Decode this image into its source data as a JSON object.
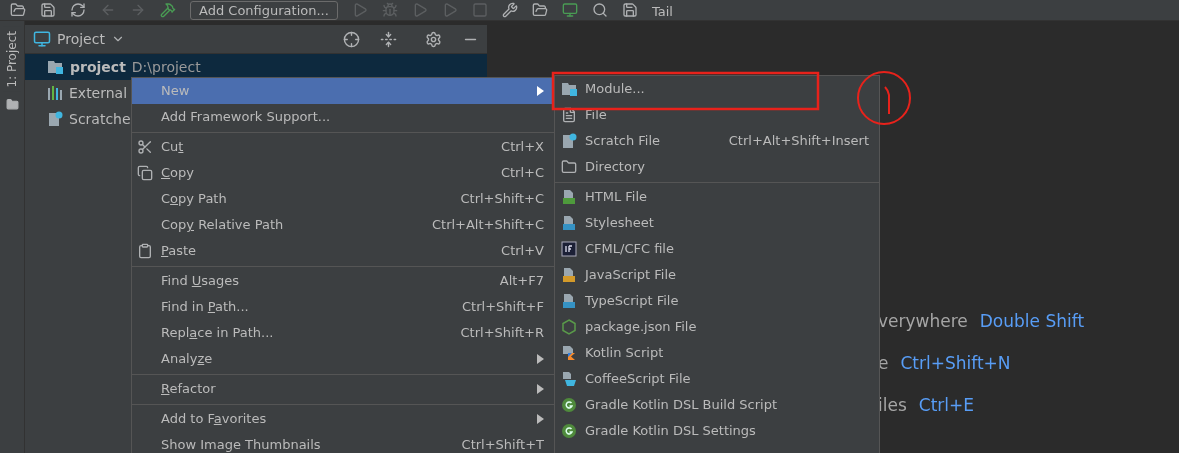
{
  "toolbar": {
    "run_config": "Add Configuration...",
    "tail": "Tail"
  },
  "side_tab": {
    "label": "1: Project",
    "selected": true
  },
  "project_panel": {
    "title": "Project",
    "tree": [
      {
        "name": "project",
        "path": "D:\\project",
        "selected": true
      },
      {
        "name": "External",
        "selected": false
      },
      {
        "name": "Scratche",
        "selected": false
      }
    ]
  },
  "editor_hints": [
    {
      "text": "verywhere",
      "shortcut": "Double Shift"
    },
    {
      "text": "e",
      "shortcut": "Ctrl+Shift+N"
    },
    {
      "text": "iles",
      "shortcut": "Ctrl+E"
    }
  ],
  "context_menu": {
    "groups": [
      [
        {
          "label": [
            {
              "text": "New"
            }
          ],
          "selected": true,
          "submenu": true
        },
        {
          "label": [
            {
              "text": "Add Framework Support..."
            }
          ],
          "selected": false,
          "submenu": false
        }
      ],
      [
        {
          "label": [
            {
              "text": "Cu"
            },
            {
              "text": "t",
              "underlined": true
            }
          ],
          "shortcut": "Ctrl+X",
          "selected": false,
          "submenu": false
        },
        {
          "label": [
            {
              "text": "C",
              "underlined": true
            },
            {
              "text": "opy"
            }
          ],
          "shortcut": "Ctrl+C",
          "selected": false,
          "submenu": false
        },
        {
          "label": [
            {
              "text": "C"
            },
            {
              "text": "o",
              "underlined": true
            },
            {
              "text": "py Path"
            }
          ],
          "shortcut": "Ctrl+Shift+C",
          "selected": false,
          "submenu": false
        },
        {
          "label": [
            {
              "text": "Cop"
            },
            {
              "text": "y",
              "underlined": true
            },
            {
              "text": " Relative Path"
            }
          ],
          "shortcut": "Ctrl+Alt+Shift+C",
          "selected": false,
          "submenu": false
        },
        {
          "label": [
            {
              "text": "P",
              "underlined": true
            },
            {
              "text": "aste"
            }
          ],
          "shortcut": "Ctrl+V",
          "selected": false,
          "submenu": false
        }
      ],
      [
        {
          "label": [
            {
              "text": "Find "
            },
            {
              "text": "U",
              "underlined": true
            },
            {
              "text": "sages"
            }
          ],
          "shortcut": "Alt+F7",
          "selected": false,
          "submenu": false
        },
        {
          "label": [
            {
              "text": "Find in "
            },
            {
              "text": "P",
              "underlined": true
            },
            {
              "text": "ath..."
            }
          ],
          "shortcut": "Ctrl+Shift+F",
          "selected": false,
          "submenu": false
        },
        {
          "label": [
            {
              "text": "Repl"
            },
            {
              "text": "a",
              "underlined": true
            },
            {
              "text": "ce in Path..."
            }
          ],
          "shortcut": "Ctrl+Shift+R",
          "selected": false,
          "submenu": false
        },
        {
          "label": [
            {
              "text": "Analy"
            },
            {
              "text": "z",
              "underlined": true
            },
            {
              "text": "e"
            }
          ],
          "selected": false,
          "submenu": true
        }
      ],
      [
        {
          "label": [
            {
              "text": "R",
              "underlined": true
            },
            {
              "text": "efactor"
            }
          ],
          "selected": false,
          "submenu": true
        }
      ],
      [
        {
          "label": [
            {
              "text": "Add to F"
            },
            {
              "text": "a",
              "underlined": true
            },
            {
              "text": "vorites"
            }
          ],
          "selected": false,
          "submenu": true
        },
        {
          "label": [
            {
              "text": "Show Image Thumbnails"
            }
          ],
          "shortcut": "Ctrl+Shift+T",
          "selected": false,
          "submenu": false
        }
      ]
    ]
  },
  "new_submenu": {
    "groups": [
      [
        {
          "label": "Module..."
        },
        {
          "label": "File"
        },
        {
          "label": "Scratch File",
          "shortcut": "Ctrl+Alt+Shift+Insert"
        },
        {
          "label": "Directory"
        }
      ],
      [
        {
          "label": "HTML File"
        },
        {
          "label": "Stylesheet"
        },
        {
          "label": "CFML/CFC file"
        },
        {
          "label": "JavaScript File"
        },
        {
          "label": "TypeScript File"
        },
        {
          "label": "package.json File"
        },
        {
          "label": "Kotlin Script"
        },
        {
          "label": "CoffeeScript File"
        },
        {
          "label": "Gradle Kotlin DSL Build Script"
        },
        {
          "label": "Gradle Kotlin DSL Settings"
        }
      ]
    ]
  }
}
